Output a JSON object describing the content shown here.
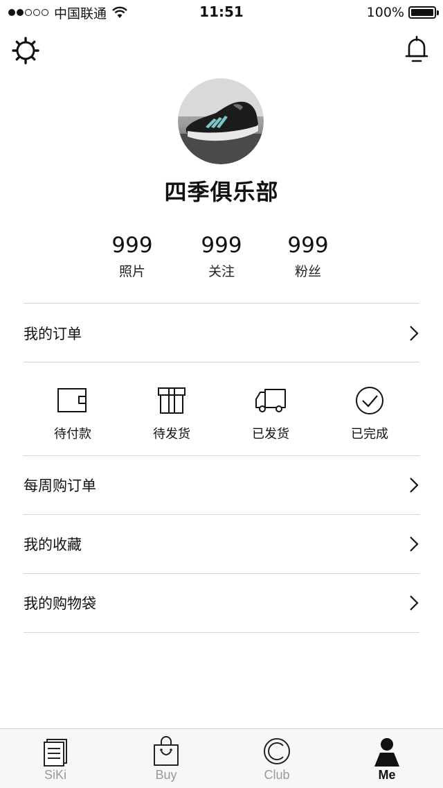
{
  "status_bar": {
    "carrier": "中国联通",
    "time": "11:51",
    "battery": "100%"
  },
  "profile": {
    "name": "四季俱乐部"
  },
  "stats": [
    {
      "value": "999",
      "label": "照片"
    },
    {
      "value": "999",
      "label": "关注"
    },
    {
      "value": "999",
      "label": "粉丝"
    }
  ],
  "menu": {
    "my_orders": "我的订单",
    "weekly_orders": "每周购订单",
    "favorites": "我的收藏",
    "shopping_bag": "我的购物袋"
  },
  "order_status": [
    {
      "label": "待付款",
      "icon": "wallet-icon"
    },
    {
      "label": "待发货",
      "icon": "gift-box-icon"
    },
    {
      "label": "已发货",
      "icon": "delivery-truck-icon"
    },
    {
      "label": "已完成",
      "icon": "check-circle-icon"
    }
  ],
  "tabbar": [
    {
      "label": "SiKi",
      "icon": "document-icon"
    },
    {
      "label": "Buy",
      "icon": "shopping-bag-icon"
    },
    {
      "label": "Club",
      "icon": "club-ring-icon"
    },
    {
      "label": "Me",
      "icon": "user-icon",
      "active": true
    }
  ],
  "colors": {
    "text": "#111111",
    "divider": "#d6d6d6",
    "tab_inactive": "#999999",
    "tab_active": "#111111",
    "tabbar_bg": "#f7f7f7"
  }
}
